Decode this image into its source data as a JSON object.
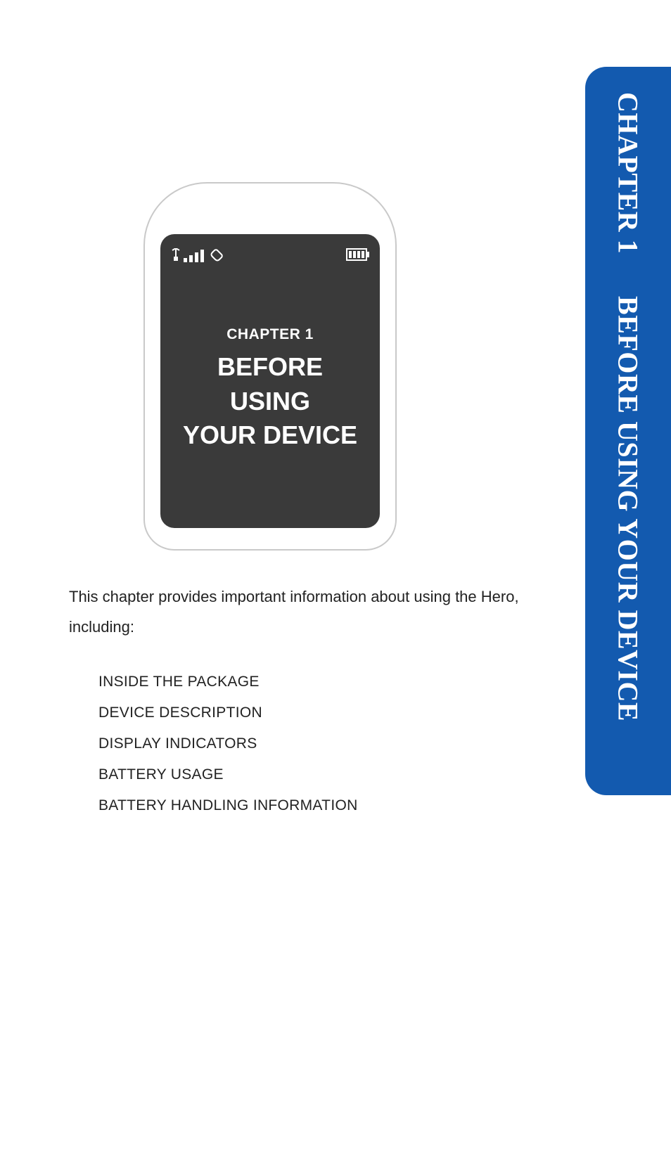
{
  "side_tab": {
    "chapter": "CHAPTER 1",
    "title": "BEFORE USING YOUR DEVICE"
  },
  "device_screen": {
    "chapter_label": "CHAPTER 1",
    "title_lines": [
      "BEFORE",
      "USING",
      "YOUR DEVICE"
    ]
  },
  "intro_text": "This chapter provides important information about using the Hero, including:",
  "toc_items": [
    "INSIDE THE PACKAGE",
    "DEVICE DESCRIPTION",
    "DISPLAY INDICATORS",
    "BATTERY USAGE",
    "BATTERY HANDLING INFORMATION"
  ]
}
